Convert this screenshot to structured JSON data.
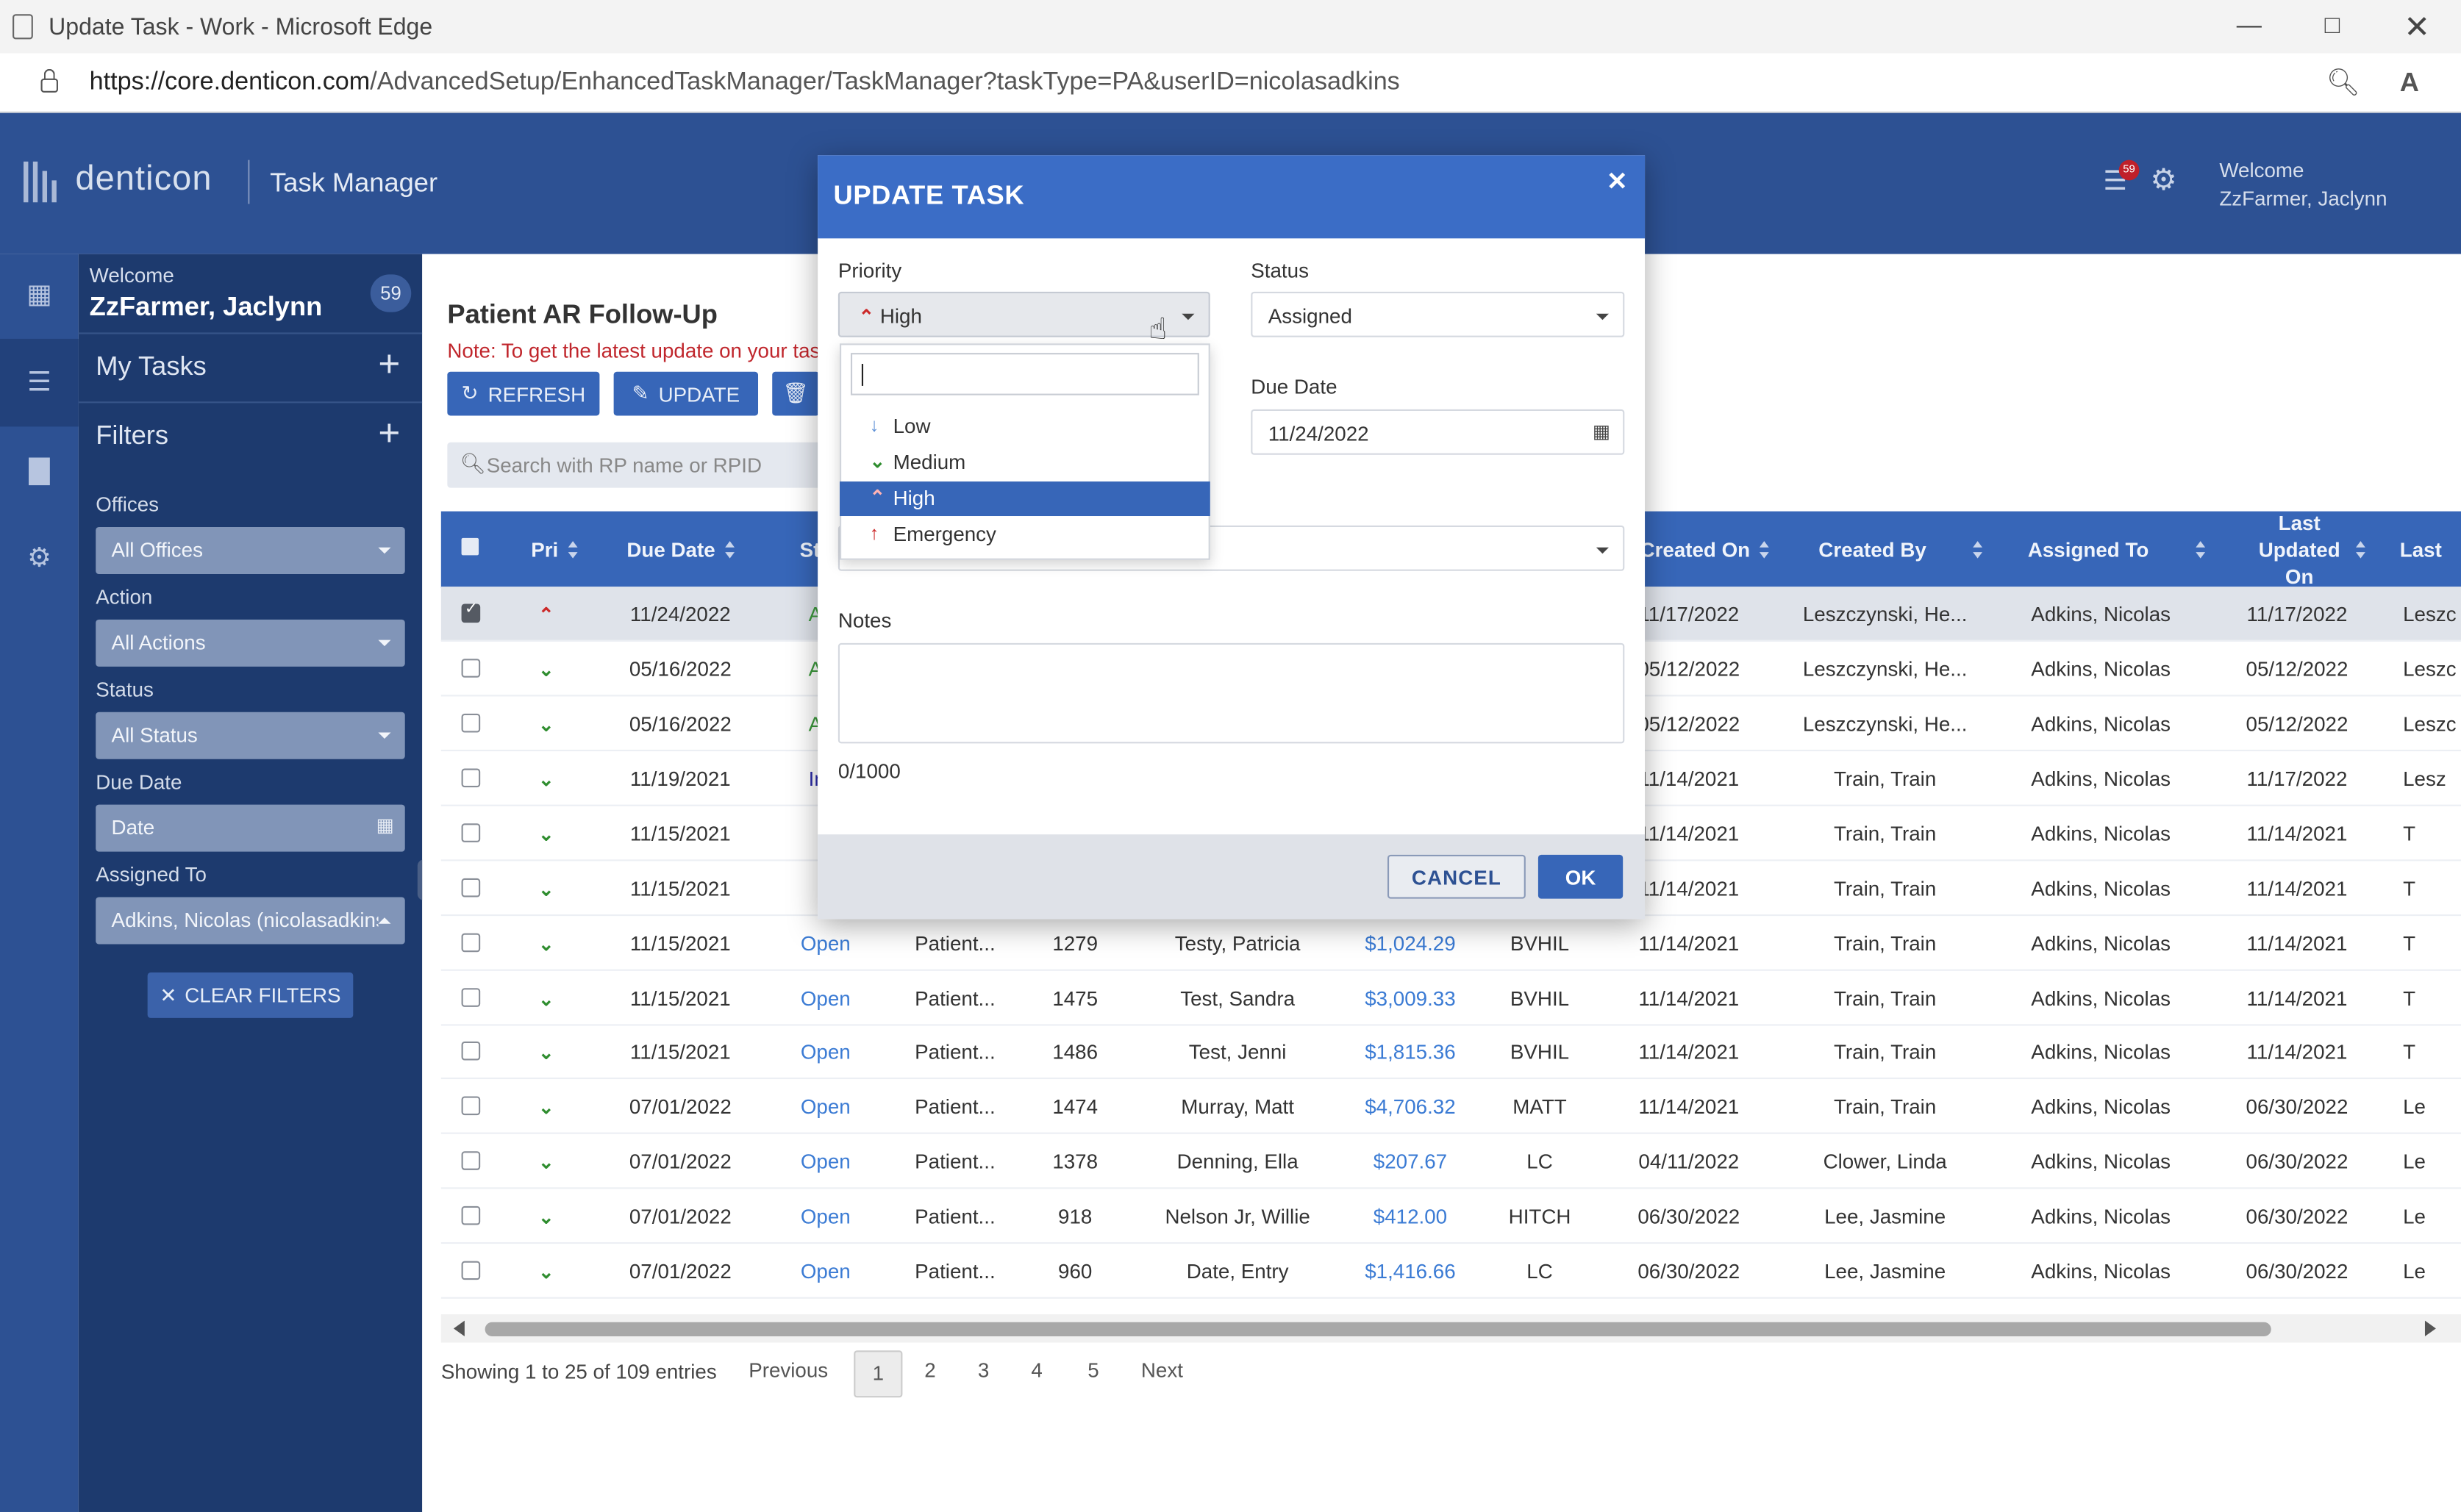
{
  "browser": {
    "title": "Update Task - Work - Microsoft Edge",
    "url_host": "https://core.denticon.com",
    "url_path": "/AdvancedSetup/EnhancedTaskManager/TaskManager?taskType=PA&userID=nicolasadkins",
    "minimize_icon": "minimize-icon",
    "maximize_icon": "maximize-icon",
    "close_icon": "close-icon"
  },
  "app": {
    "logo": "denticon",
    "title": "Task Manager",
    "notification_count": "59",
    "welcome_line1": "Welcome",
    "welcome_line2": "ZzFarmer, Jaclynn"
  },
  "sidebar": {
    "welcome": "Welcome",
    "user": "ZzFarmer, Jaclynn",
    "task_count": "59",
    "my_tasks": "My Tasks",
    "filters": "Filters",
    "offices_label": "Offices",
    "offices_value": "All Offices",
    "action_label": "Action",
    "action_value": "All Actions",
    "status_label": "Status",
    "status_value": "All Status",
    "due_date_label": "Due Date",
    "due_date_value": "Date",
    "assigned_to_label": "Assigned To",
    "assigned_to_value": "Adkins, Nicolas (nicolasadkins)",
    "clear_filters": "CLEAR FILTERS"
  },
  "main": {
    "title": "Patient AR Follow-Up",
    "note": "Note: To get the latest update on your tasks",
    "refresh": "REFRESH",
    "update": "UPDATE",
    "search_placeholder": "Search with RP name or RPID"
  },
  "table": {
    "headers": {
      "pri": "Pri",
      "due_date": "Due Date",
      "status": "St",
      "created_on": "Created On",
      "created_by": "Created By",
      "assigned_to": "Assigned To",
      "last_updated_on": "Last Updated On",
      "last": "Last"
    },
    "rows": [
      {
        "pri": "high",
        "due": "11/24/2022",
        "status": "Ass",
        "action": "",
        "rpid": "",
        "name": "",
        "amount": "",
        "office": "",
        "created_on": "11/17/2022",
        "created_by": "Leszczynski, He...",
        "assigned_to": "Adkins, Nicolas",
        "updated_on": "11/17/2022",
        "last": "Leszc"
      },
      {
        "pri": "med",
        "due": "05/16/2022",
        "status": "Ass",
        "action": "",
        "rpid": "",
        "name": "",
        "amount": "",
        "office": "",
        "created_on": "05/12/2022",
        "created_by": "Leszczynski, He...",
        "assigned_to": "Adkins, Nicolas",
        "updated_on": "05/12/2022",
        "last": "Leszc"
      },
      {
        "pri": "med",
        "due": "05/16/2022",
        "status": "Ass",
        "action": "",
        "rpid": "",
        "name": "",
        "amount": "",
        "office": "",
        "created_on": "05/12/2022",
        "created_by": "Leszczynski, He...",
        "assigned_to": "Adkins, Nicolas",
        "updated_on": "05/12/2022",
        "last": "Leszc"
      },
      {
        "pri": "med",
        "due": "11/19/2021",
        "status": "In p",
        "action": "",
        "rpid": "",
        "name": "",
        "amount": "",
        "office": "",
        "created_on": "11/14/2021",
        "created_by": "Train, Train",
        "assigned_to": "Adkins, Nicolas",
        "updated_on": "11/17/2022",
        "last": "Lesz"
      },
      {
        "pri": "med",
        "due": "11/15/2021",
        "status": "O",
        "action": "",
        "rpid": "",
        "name": "",
        "amount": "",
        "office": "",
        "created_on": "11/14/2021",
        "created_by": "Train, Train",
        "assigned_to": "Adkins, Nicolas",
        "updated_on": "11/14/2021",
        "last": "T"
      },
      {
        "pri": "med",
        "due": "11/15/2021",
        "status": "O",
        "action": "",
        "rpid": "",
        "name": "",
        "amount": "",
        "office": "",
        "created_on": "11/14/2021",
        "created_by": "Train, Train",
        "assigned_to": "Adkins, Nicolas",
        "updated_on": "11/14/2021",
        "last": "T"
      },
      {
        "pri": "med",
        "due": "11/15/2021",
        "status": "Open",
        "action": "Patient...",
        "rpid": "1279",
        "name": "Testy, Patricia",
        "amount": "$1,024.29",
        "office": "BVHIL",
        "created_on": "11/14/2021",
        "created_by": "Train, Train",
        "assigned_to": "Adkins, Nicolas",
        "updated_on": "11/14/2021",
        "last": "T"
      },
      {
        "pri": "med",
        "due": "11/15/2021",
        "status": "Open",
        "action": "Patient...",
        "rpid": "1475",
        "name": "Test, Sandra",
        "amount": "$3,009.33",
        "office": "BVHIL",
        "created_on": "11/14/2021",
        "created_by": "Train, Train",
        "assigned_to": "Adkins, Nicolas",
        "updated_on": "11/14/2021",
        "last": "T"
      },
      {
        "pri": "med",
        "due": "11/15/2021",
        "status": "Open",
        "action": "Patient...",
        "rpid": "1486",
        "name": "Test, Jenni",
        "amount": "$1,815.36",
        "office": "BVHIL",
        "created_on": "11/14/2021",
        "created_by": "Train, Train",
        "assigned_to": "Adkins, Nicolas",
        "updated_on": "11/14/2021",
        "last": "T"
      },
      {
        "pri": "med",
        "due": "07/01/2022",
        "status": "Open",
        "action": "Patient...",
        "rpid": "1474",
        "name": "Murray, Matt",
        "amount": "$4,706.32",
        "office": "MATT",
        "created_on": "11/14/2021",
        "created_by": "Train, Train",
        "assigned_to": "Adkins, Nicolas",
        "updated_on": "06/30/2022",
        "last": "Le"
      },
      {
        "pri": "med",
        "due": "07/01/2022",
        "status": "Open",
        "action": "Patient...",
        "rpid": "1378",
        "name": "Denning, Ella",
        "amount": "$207.67",
        "office": "LC",
        "created_on": "04/11/2022",
        "created_by": "Clower, Linda",
        "assigned_to": "Adkins, Nicolas",
        "updated_on": "06/30/2022",
        "last": "Le"
      },
      {
        "pri": "med",
        "due": "07/01/2022",
        "status": "Open",
        "action": "Patient...",
        "rpid": "918",
        "name": "Nelson Jr, Willie",
        "amount": "$412.00",
        "office": "HITCH",
        "created_on": "06/30/2022",
        "created_by": "Lee, Jasmine",
        "assigned_to": "Adkins, Nicolas",
        "updated_on": "06/30/2022",
        "last": "Le"
      },
      {
        "pri": "med",
        "due": "07/01/2022",
        "status": "Open",
        "action": "Patient...",
        "rpid": "960",
        "name": "Date, Entry",
        "amount": "$1,416.66",
        "office": "LC",
        "created_on": "06/30/2022",
        "created_by": "Lee, Jasmine",
        "assigned_to": "Adkins, Nicolas",
        "updated_on": "06/30/2022",
        "last": "Le"
      }
    ]
  },
  "pagination": {
    "entries": "Showing 1 to 25 of 109 entries",
    "previous": "Previous",
    "pages": [
      "1",
      "2",
      "3",
      "4",
      "5"
    ],
    "next": "Next"
  },
  "modal": {
    "title": "UPDATE TASK",
    "priority_label": "Priority",
    "priority_value": "High",
    "status_label": "Status",
    "status_value": "Assigned",
    "due_date_label": "Due Date",
    "due_date_value": "11/24/2022",
    "notes_label": "Notes",
    "notes_value": "",
    "counter": "0/1000",
    "cancel": "CANCEL",
    "ok": "OK",
    "options": [
      {
        "label": "Low",
        "icon": "arrow-down-icon"
      },
      {
        "label": "Medium",
        "icon": "double-chevron-down-icon"
      },
      {
        "label": "High",
        "icon": "double-chevron-up-icon"
      },
      {
        "label": "Emergency",
        "icon": "arrow-up-icon"
      }
    ],
    "selected_option": "High"
  },
  "colors": {
    "header_blue": "#2d5193",
    "sidebar_navy": "#1d3a6e",
    "table_header": "#3766b8",
    "modal_header": "#3b6dc6",
    "priority_high": "#cc2a2a",
    "priority_medium": "#2f8d2f",
    "link_blue": "#3b7bd4"
  }
}
